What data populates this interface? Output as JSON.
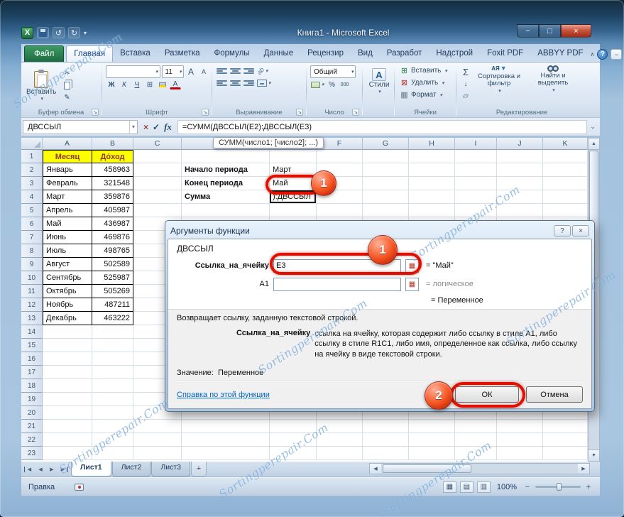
{
  "watermark": "Sortingperepair.Com",
  "window": {
    "title": "Книга1  -  Microsoft Excel"
  },
  "icons": {
    "caret_down": "▾",
    "expand": "⌄",
    "collapse": "∧",
    "help": "?",
    "minimize": "−",
    "maximize": "□",
    "close": "×",
    "undo": "↺",
    "redo": "↻",
    "cut": "✂",
    "brush": "✎",
    "sigma": "Σ",
    "check": "✓",
    "cancel": "×",
    "fx": "fx",
    "letter_a": "А",
    "borders": "⊞",
    "percent": "%",
    "zeros": "000",
    "orientation": "ab",
    "sort_az": "АЯ",
    "funnel": "▼",
    "fill_down": "↓",
    "eraser": "▱",
    "insert_cells": "⊞",
    "delete_cells": "⊠",
    "format_cells": "▦",
    "left": "◀",
    "right": "▶",
    "up": "▲",
    "down": "▼",
    "view_normal": "▦",
    "view_layout": "▤",
    "view_break": "▥",
    "zoom_out": "−",
    "zoom_in": "+",
    "plus": "+",
    "range_select": "▦",
    "excel_logo": "X"
  },
  "ribbon": {
    "tabs": [
      {
        "label": "Файл",
        "type": "file"
      },
      {
        "label": "Главная",
        "type": "active"
      },
      {
        "label": "Вставка"
      },
      {
        "label": "Разметка"
      },
      {
        "label": "Формулы"
      },
      {
        "label": "Данные"
      },
      {
        "label": "Рецензир"
      },
      {
        "label": "Вид"
      },
      {
        "label": "Разработ"
      },
      {
        "label": "Надстрой"
      },
      {
        "label": "Foxit PDF"
      },
      {
        "label": "ABBYY PDF"
      }
    ],
    "clipboard": {
      "label": "Буфер обмена",
      "paste": "Вставить"
    },
    "font": {
      "label": "Шрифт",
      "size": "11",
      "bold": "Ж",
      "italic": "К",
      "underline": "Ч"
    },
    "alignment": {
      "label": "Выравнивание"
    },
    "number": {
      "label": "Число",
      "format": "Общий"
    },
    "styles": {
      "label": "Стили",
      "button": "Стили"
    },
    "cells": {
      "label": "Ячейки",
      "buttons": [
        "Вставить",
        "Удалить",
        "Формат"
      ]
    },
    "editing": {
      "label": "Редактирование",
      "sort": "Сортировка и фильтр",
      "find": "Найти и выделить"
    }
  },
  "formula_bar": {
    "name_box": "ДВССЫЛ",
    "fx": "fx",
    "formula": "=СУММ(ДВССЫЛ(E2):ДВССЫЛ(E3)"
  },
  "tooltip": "СУММ(число1; [число2]; ...)",
  "grid": {
    "columns": [
      "A",
      "B",
      "C",
      "D",
      "E",
      "F",
      "G",
      "H",
      "I",
      "J",
      "K"
    ],
    "row_count": 23,
    "table": {
      "headers": [
        "Месяц",
        "До́ход"
      ],
      "rows": [
        [
          "Январь",
          "458963"
        ],
        [
          "Февраль",
          "321548"
        ],
        [
          "Март",
          "359876"
        ],
        [
          "Апрель",
          "405987"
        ],
        [
          "Май",
          "436987"
        ],
        [
          "Июнь",
          "469876"
        ],
        [
          "Июль",
          "498765"
        ],
        [
          "Август",
          "502589"
        ],
        [
          "Сентябрь",
          "525987"
        ],
        [
          "Октябрь",
          "505269"
        ],
        [
          "Ноябрь",
          "487211"
        ],
        [
          "Декабрь",
          "463222"
        ]
      ]
    },
    "period": [
      {
        "label": "Начало периода",
        "value": "Март"
      },
      {
        "label": "Конец периода",
        "value": "Май"
      },
      {
        "label": "Сумма",
        "value": "):ДВССЫЛ"
      }
    ]
  },
  "dialog": {
    "title": "Аргументы функции",
    "function_name": "ДВССЫЛ",
    "fields": [
      {
        "label": "Ссылка_на_ячейку",
        "value": "E3",
        "result": "=  \"Май\""
      },
      {
        "label": "A1",
        "value": "",
        "result": "=  логическое"
      }
    ],
    "result": "=  Переменное",
    "description": "Возвращает ссылку, заданную текстовой строкой.",
    "arg_label": "Ссылка_на_ячейку",
    "arg_description": "ссылка на ячейку, которая содержит либо ссылку в стиле A1, либо ссылку в стиле R1C1, либо имя, определенное как ссылка, либо ссылку на ячейку в виде текстовой строки.",
    "value_label": "Значение:",
    "value_text": "Переменное",
    "help_link": "Справка по этой функции",
    "ok_label": "ОК",
    "cancel_label": "Отмена"
  },
  "sheet_tabs": [
    "Лист1",
    "Лист2",
    "Лист3"
  ],
  "status_bar": {
    "mode": "Правка",
    "zoom": "100%"
  },
  "annotations": {
    "step1": "1",
    "step2": "2"
  }
}
